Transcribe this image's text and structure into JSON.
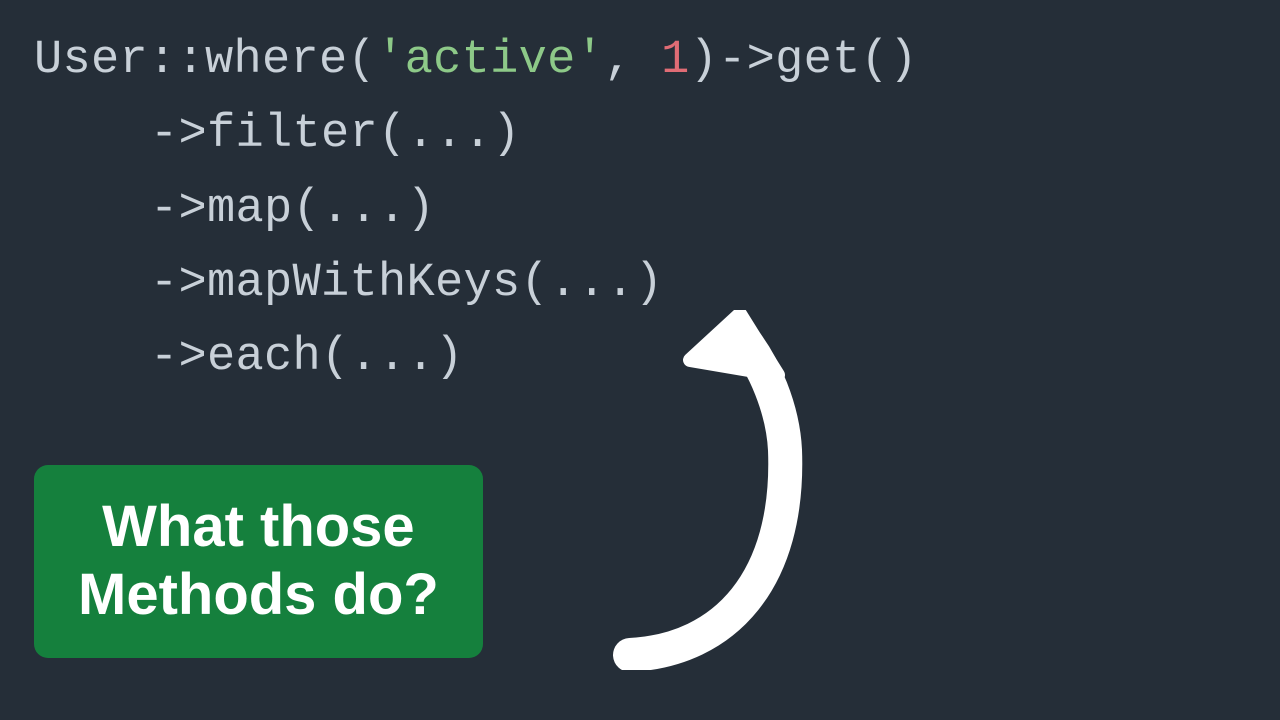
{
  "code": {
    "line1": {
      "prefix": "User::where(",
      "string": "'active'",
      "comma": ", ",
      "number": "1",
      "suffix": ")->get()"
    },
    "line2": "->filter(...)",
    "line3": "->map(...)",
    "line4": "->mapWithKeys(...)",
    "line5": "->each(...)"
  },
  "callout": {
    "line1": "What those",
    "line2": "Methods do?"
  }
}
